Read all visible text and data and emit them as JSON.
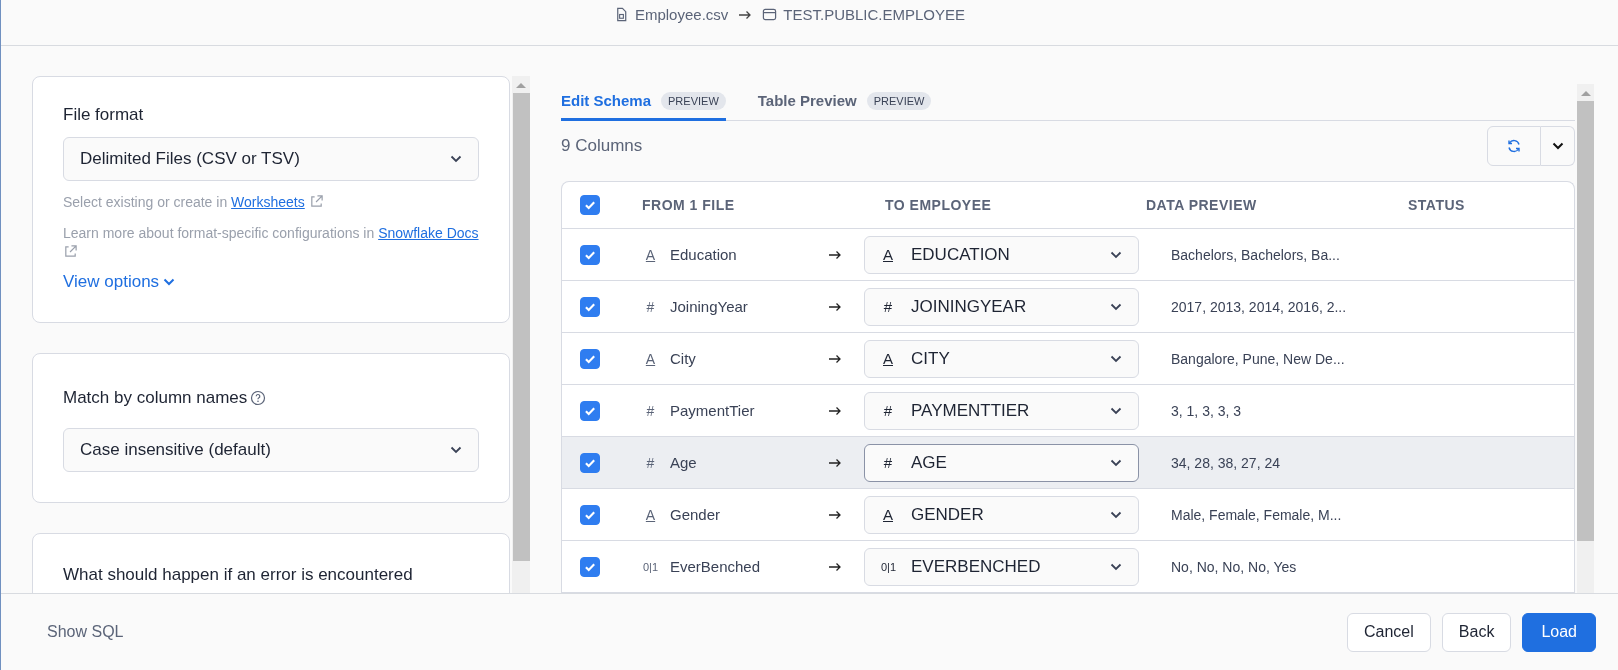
{
  "header": {
    "source_file": "Employee.csv",
    "target_table": "TEST.PUBLIC.EMPLOYEE"
  },
  "left_panel": {
    "file_format": {
      "label": "File format",
      "value": "Delimited Files (CSV or TSV)",
      "hint_text": "Select existing or create in",
      "hint_link": "Worksheets",
      "docs_text": "Learn more about format-specific configurations in",
      "docs_link": "Snowflake Docs",
      "view_options": "View options"
    },
    "match": {
      "label": "Match by column names",
      "value": "Case insensitive (default)"
    },
    "error_question": "What should happen if an error is encountered"
  },
  "tabs": [
    {
      "label": "Edit Schema",
      "badge": "PREVIEW",
      "selected": true
    },
    {
      "label": "Table Preview",
      "badge": "PREVIEW",
      "selected": false
    }
  ],
  "column_count": "9 Columns",
  "table": {
    "all_checked": true,
    "columns": [
      "FROM 1 FILE",
      "TO EMPLOYEE",
      "DATA PREVIEW",
      "STATUS"
    ],
    "rows": [
      {
        "checked": true,
        "source_icon": "A",
        "target_icon": "A",
        "kind": "text",
        "source": "Education",
        "target": "EDUCATION",
        "preview": "Bachelors, Bachelors, Ba...",
        "highlighted": false
      },
      {
        "checked": true,
        "source_icon": "#",
        "target_icon": "#",
        "kind": "number",
        "source": "JoiningYear",
        "target": "JOININGYEAR",
        "preview": "2017, 2013, 2014, 2016, 2...",
        "highlighted": false
      },
      {
        "checked": true,
        "source_icon": "A",
        "target_icon": "A",
        "kind": "text",
        "source": "City",
        "target": "CITY",
        "preview": "Bangalore, Pune, New De...",
        "highlighted": false
      },
      {
        "checked": true,
        "source_icon": "#",
        "target_icon": "#",
        "kind": "number",
        "source": "PaymentTier",
        "target": "PAYMENTTIER",
        "preview": "3, 1, 3, 3, 3",
        "highlighted": false
      },
      {
        "checked": true,
        "source_icon": "#",
        "target_icon": "#",
        "kind": "number",
        "source": "Age",
        "target": "AGE",
        "preview": "34, 28, 38, 27, 24",
        "highlighted": true
      },
      {
        "checked": true,
        "source_icon": "A",
        "target_icon": "A",
        "kind": "text",
        "source": "Gender",
        "target": "GENDER",
        "preview": "Male, Female, Female, M...",
        "highlighted": false
      },
      {
        "checked": true,
        "source_icon": "0|1",
        "target_icon": "0|1",
        "kind": "boolean",
        "source": "EverBenched",
        "target": "EVERBENCHED",
        "preview": "No, No, No, No, Yes",
        "highlighted": false
      }
    ]
  },
  "footer": {
    "show_sql": "Show SQL",
    "buttons": [
      {
        "label": "Cancel",
        "kind": "secondary"
      },
      {
        "label": "Back",
        "kind": "secondary"
      },
      {
        "label": "Load",
        "kind": "primary"
      }
    ]
  }
}
